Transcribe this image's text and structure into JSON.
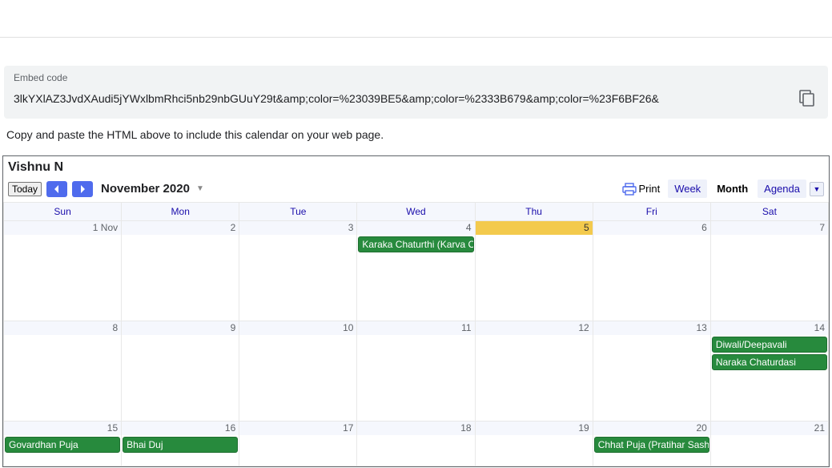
{
  "embed": {
    "label": "Embed code",
    "code": "3lkYXlAZ3JvdXAudi5jYWxlbmRhci5nb29nbGUuY29t&amp;color=%23039BE5&amp;color=%2333B679&amp;color=%23F6BF26&"
  },
  "help_text": "Copy and paste the HTML above to include this calendar on your web page.",
  "calendar": {
    "title": "Vishnu N",
    "today_btn": "Today",
    "month_label": "November 2020",
    "print_label": "Print",
    "views": {
      "week": "Week",
      "month": "Month",
      "agenda": "Agenda"
    },
    "days": [
      "Sun",
      "Mon",
      "Tue",
      "Wed",
      "Thu",
      "Fri",
      "Sat"
    ],
    "weeks": [
      [
        {
          "label": "1 Nov"
        },
        {
          "label": "2"
        },
        {
          "label": "3"
        },
        {
          "label": "4",
          "events": [
            "Karaka Chaturthi (Karva Chauth)"
          ]
        },
        {
          "label": "5",
          "today": true
        },
        {
          "label": "6"
        },
        {
          "label": "7"
        }
      ],
      [
        {
          "label": "8"
        },
        {
          "label": "9"
        },
        {
          "label": "10"
        },
        {
          "label": "11"
        },
        {
          "label": "12"
        },
        {
          "label": "13"
        },
        {
          "label": "14",
          "events": [
            "Diwali/Deepavali",
            "Naraka Chaturdasi"
          ]
        }
      ],
      [
        {
          "label": "15",
          "events": [
            "Govardhan Puja"
          ]
        },
        {
          "label": "16",
          "events": [
            "Bhai Duj"
          ]
        },
        {
          "label": "17"
        },
        {
          "label": "18"
        },
        {
          "label": "19"
        },
        {
          "label": "20",
          "events": [
            "Chhat Puja (Pratihar Sashthi/Surya Sashthi)"
          ]
        },
        {
          "label": "21"
        }
      ]
    ]
  }
}
